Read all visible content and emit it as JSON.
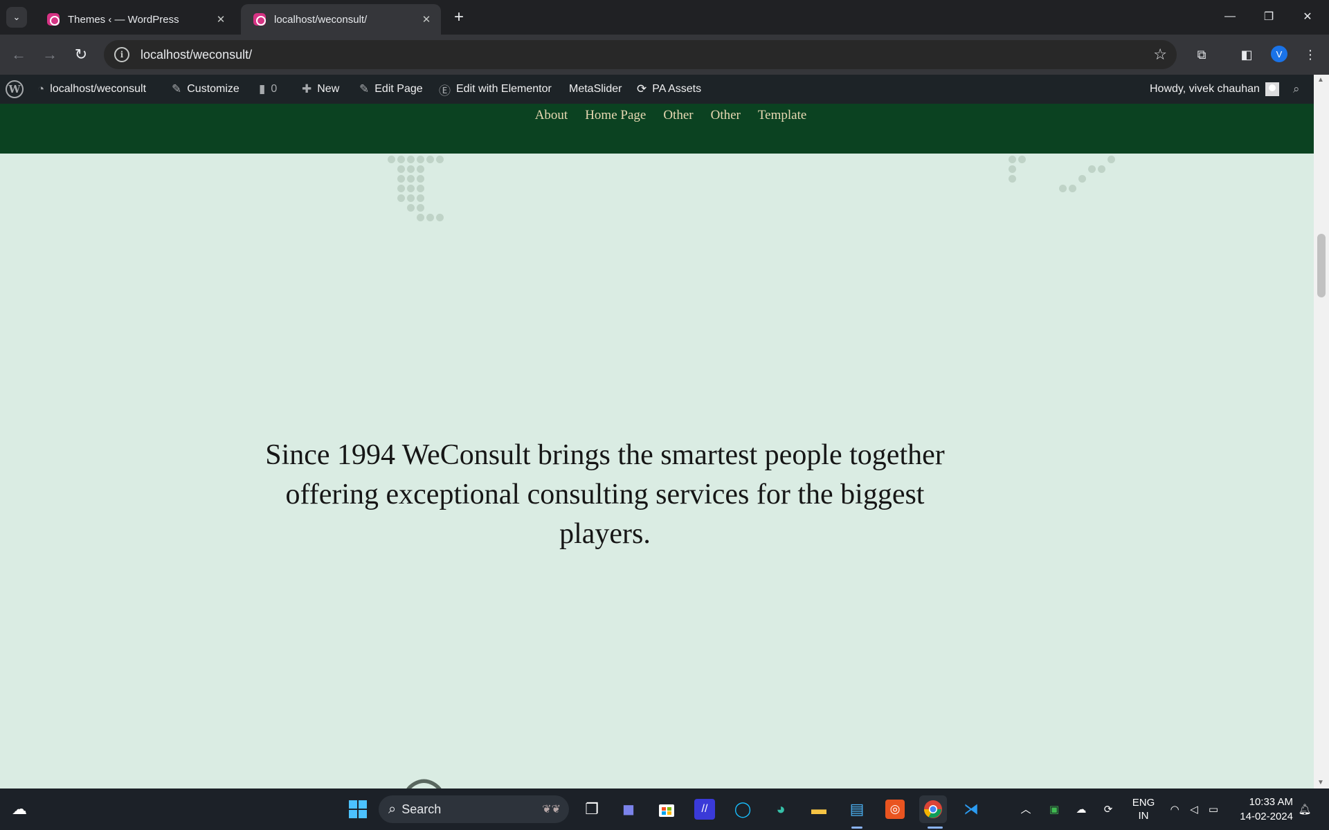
{
  "browser": {
    "tabs": [
      {
        "title": "Themes ‹ — WordPress",
        "active": false
      },
      {
        "title": "localhost/weconsult/",
        "active": true
      }
    ],
    "url": "localhost/weconsult/",
    "profile_initial": "V"
  },
  "adminbar": {
    "site": "localhost/weconsult",
    "customize": "Customize",
    "comments_count": "0",
    "new": "New",
    "edit_page": "Edit Page",
    "elementor": "Edit with Elementor",
    "metaslider": "MetaSlider",
    "pa_assets": "PA Assets",
    "howdy": "Howdy, vivek chauhan"
  },
  "site_nav": [
    "About",
    "Home Page",
    "Other",
    "Other",
    "Template"
  ],
  "hero": {
    "tagline": "Since 1994 WeConsult brings the smartest people together offering exceptional consulting services for the biggest players."
  },
  "taskbar": {
    "search_placeholder": "Search",
    "lang_top": "ENG",
    "lang_bottom": "IN",
    "time": "10:33 AM",
    "date": "14-02-2024"
  },
  "colors": {
    "nav_bg": "#0b4221",
    "page_bg": "#daece3",
    "nav_link": "#e8d9b3"
  }
}
